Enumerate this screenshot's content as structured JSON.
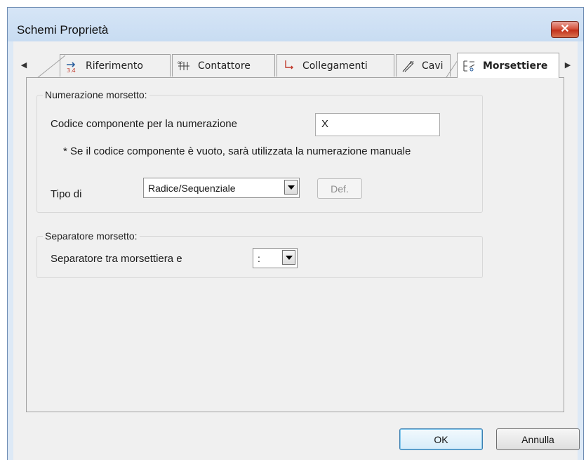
{
  "window": {
    "title": "Schemi Proprietà",
    "close_label": "✕"
  },
  "tabs": [
    {
      "label": "Riferimento",
      "icon": "cross-reference-icon"
    },
    {
      "label": "Contattore",
      "icon": "contactor-icon"
    },
    {
      "label": "Collegamenti",
      "icon": "connections-icon"
    },
    {
      "label": "Cavi",
      "icon": "cables-icon"
    },
    {
      "label": "Morsettiere",
      "icon": "terminal-strip-icon",
      "active": true
    }
  ],
  "numbering_group": {
    "title": "Numerazione morsetto:",
    "component_code_label": "Codice componente per la numerazione",
    "component_code_value": "X",
    "note": "* Se il codice componente è vuoto, sarà utilizzata la numerazione manuale",
    "type_label": "Tipo di",
    "type_value": "Radice/Sequenziale",
    "def_button": "Def."
  },
  "separator_group": {
    "title": "Separatore morsetto:",
    "separator_label": "Separatore tra morsettiera e",
    "separator_value": ":"
  },
  "buttons": {
    "ok": "OK",
    "cancel": "Annulla"
  }
}
